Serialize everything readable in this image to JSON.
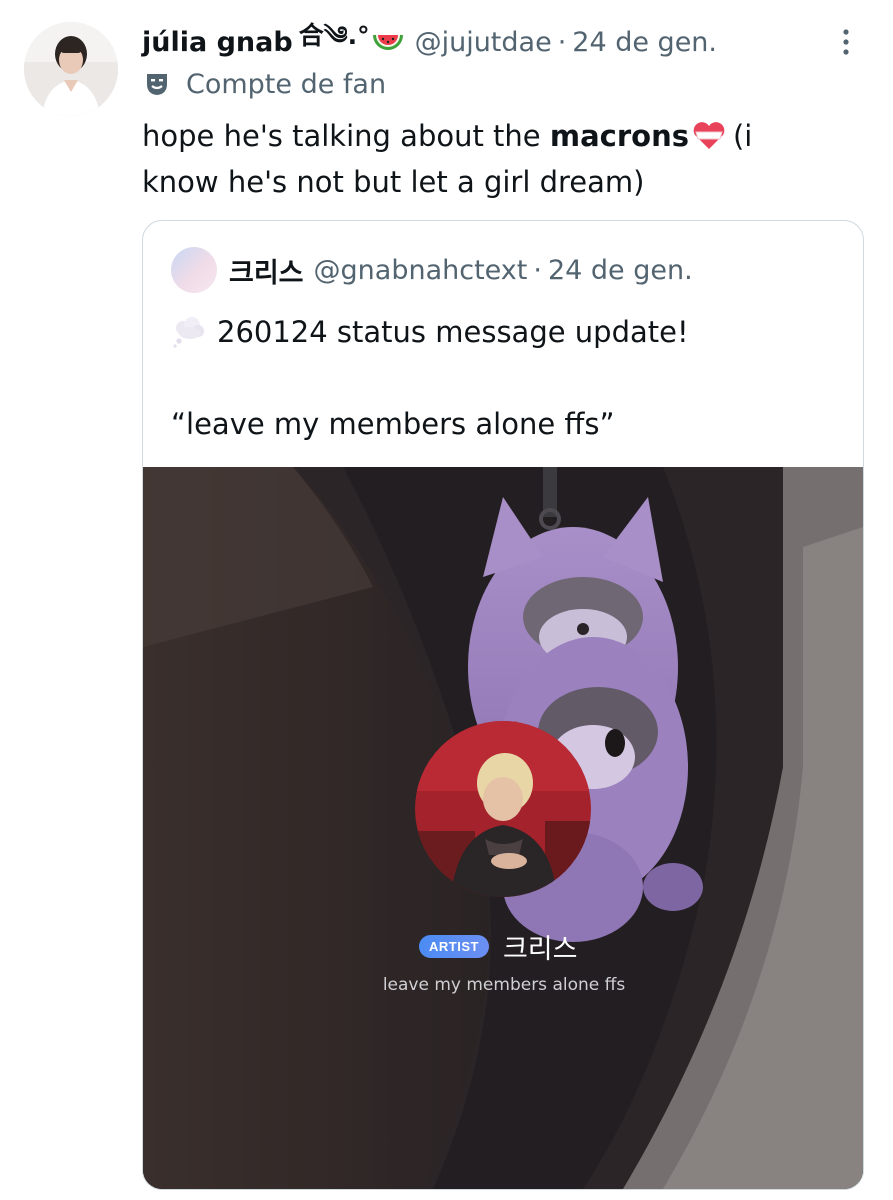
{
  "tweet": {
    "author": {
      "display_name": "júlia gnab",
      "name_decoration": "合༄.°",
      "name_emoji": "watermelon-icon",
      "handle": "@jujutdae",
      "separator": "·",
      "date": "24 de gen.",
      "account_label": "Compte de fan"
    },
    "text": {
      "before_bold": "hope he's talking about the ",
      "bold": "macrons",
      "after_bold_line1": "(i",
      "line2": "know he's not but let a girl dream)"
    }
  },
  "quote": {
    "author": {
      "display_name": "크리스",
      "handle": "@gnabnahctext",
      "separator": "·",
      "date": "24 de gen."
    },
    "line1": "260124 status message update!",
    "line2": "“leave my members alone ffs”",
    "media": {
      "badge": "ARTIST",
      "artist_name": "크리스",
      "status_message": "leave my members alone ffs"
    }
  },
  "colors": {
    "text_primary": "#0f1419",
    "text_secondary": "#536471",
    "card_border": "#cfd9de",
    "badge_blue": "#4b8cf3"
  }
}
